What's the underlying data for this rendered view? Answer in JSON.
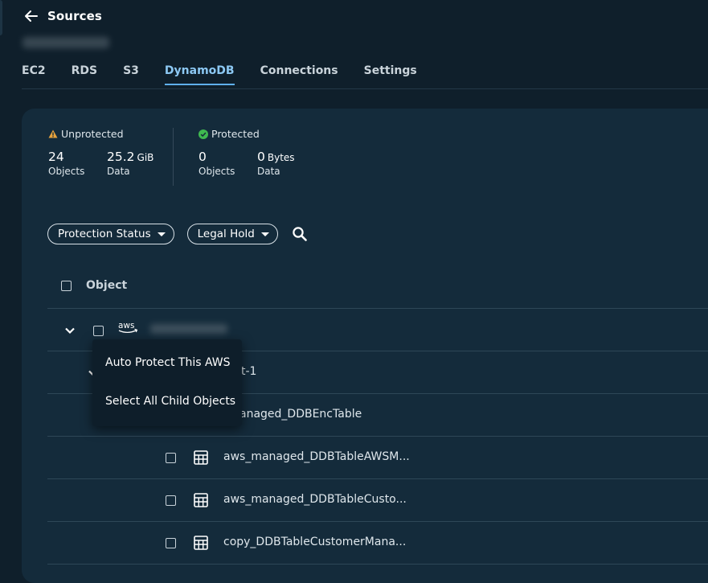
{
  "header": {
    "title": "Sources"
  },
  "tabs": [
    {
      "label": "EC2"
    },
    {
      "label": "RDS"
    },
    {
      "label": "S3"
    },
    {
      "label": "DynamoDB"
    },
    {
      "label": "Connections"
    },
    {
      "label": "Settings"
    }
  ],
  "active_tab": "DynamoDB",
  "stats": {
    "unprotected": {
      "label": "Unprotected",
      "objects_value": "24",
      "objects_label": "Objects",
      "data_value": "25.2",
      "data_unit": "GiB",
      "data_label": "Data"
    },
    "protected": {
      "label": "Protected",
      "objects_value": "0",
      "objects_label": "Objects",
      "data_value": "0",
      "data_unit": "Bytes",
      "data_label": "Data"
    }
  },
  "filters": {
    "protection_status": "Protection Status",
    "legal_hold": "Legal Hold"
  },
  "table": {
    "header": "Object",
    "aws_logo_text": "aws",
    "region_suffix": "t-1",
    "rows": [
      {
        "name": "anaged_DDBEncTable"
      },
      {
        "name": "aws_managed_DDBTableAWSM..."
      },
      {
        "name": "aws_managed_DDBTableCusto..."
      },
      {
        "name": "copy_DDBTableCustomerMana..."
      }
    ]
  },
  "context_menu": {
    "items": [
      {
        "label": "Auto Protect This AWS"
      },
      {
        "label": "Select All Child Objects"
      }
    ]
  },
  "colors": {
    "background": "#0f1f2b",
    "panel": "#142b3b",
    "accent": "#5fb0ec",
    "warning": "#e8a33d",
    "success": "#3fb950"
  }
}
